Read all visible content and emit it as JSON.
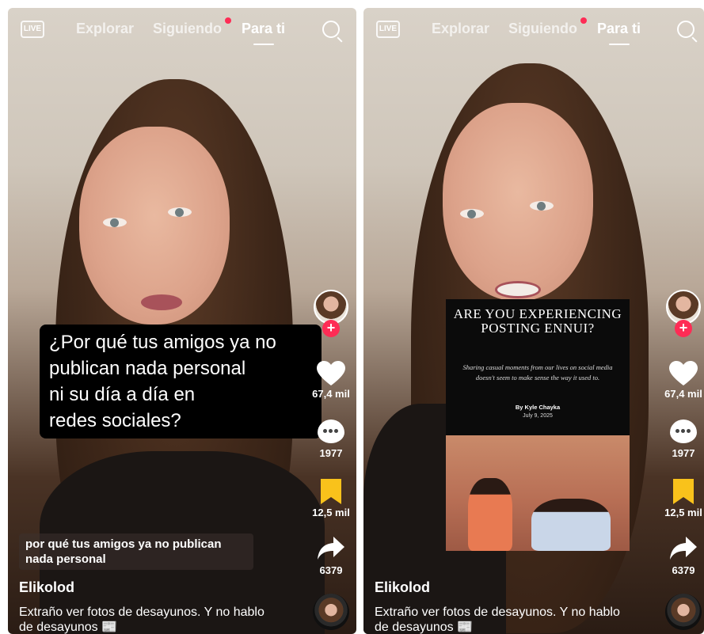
{
  "colors": {
    "accent": "#fe2c55",
    "bookmark": "#f9c21b"
  },
  "nav": {
    "live_label": "LIVE",
    "tabs": [
      "Explorar",
      "Siguiendo",
      "Para ti"
    ],
    "active_tab": "Para ti",
    "search_icon": "search-icon"
  },
  "left": {
    "caption_lines": [
      "¿Por qué tus amigos ya no",
      "publican nada personal",
      "ni su día a día en",
      "redes sociales?"
    ],
    "subtitle": "por qué tus amigos ya no publican nada personal",
    "username": "Elikolod",
    "description": "Extraño ver fotos de desayunos. Y no hablo de desayunos 📰",
    "likes": "67,4 mil",
    "comments": "1977",
    "saves": "12,5 mil",
    "shares": "6379"
  },
  "right": {
    "article": {
      "title": "ARE YOU EXPERIENCING POSTING ENNUI?",
      "body": "Sharing casual moments from our lives on social media doesn't seem to make sense the way it used to.",
      "byline": "By Kyle Chayka",
      "date": "July 9, 2025"
    },
    "username": "Elikolod",
    "description": "Extraño ver fotos de desayunos. Y no hablo de desayunos 📰",
    "likes": "67,4 mil",
    "comments": "1977",
    "saves": "12,5 mil",
    "shares": "6379"
  }
}
